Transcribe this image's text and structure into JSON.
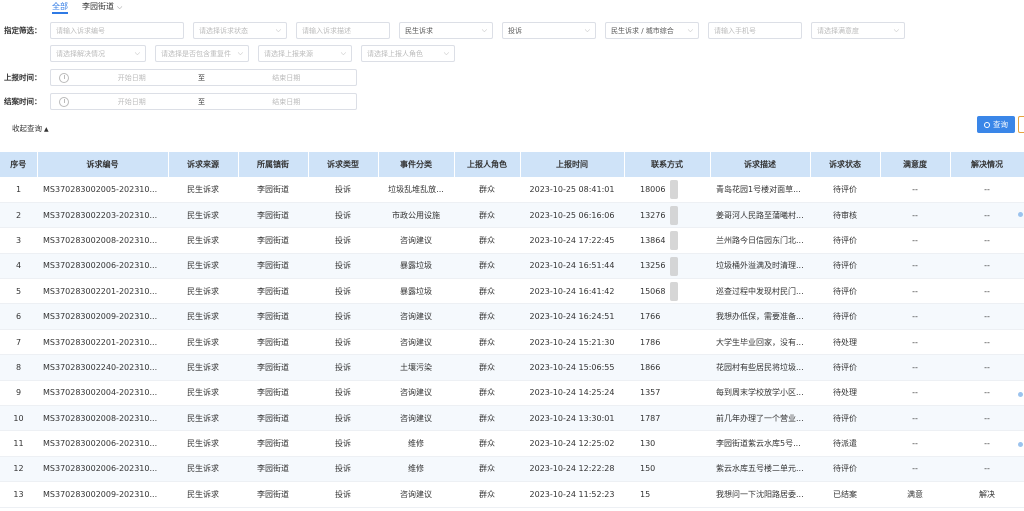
{
  "tabs": [
    {
      "label": "全部"
    },
    {
      "label": "李园街道"
    }
  ],
  "filters": {
    "label": "指定筛选：",
    "row1": [
      {
        "text": "请输入诉求编号",
        "filled": false,
        "arrow": false,
        "w": 134
      },
      {
        "text": "请选择诉求状态",
        "filled": false,
        "arrow": true,
        "w": 94
      },
      {
        "text": "请输入诉求描述",
        "filled": false,
        "arrow": false,
        "w": 94
      },
      {
        "text": "民生诉求",
        "filled": true,
        "arrow": true,
        "w": 94
      },
      {
        "text": "投诉",
        "filled": true,
        "arrow": true,
        "w": 94
      },
      {
        "text": "民生诉求 / 城市综合",
        "filled": true,
        "arrow": true,
        "w": 94
      },
      {
        "text": "请输入手机号",
        "filled": false,
        "arrow": false,
        "w": 94
      },
      {
        "text": "请选择满意度",
        "filled": false,
        "arrow": true,
        "w": 94
      }
    ],
    "row2": [
      {
        "text": "请选择解决情况",
        "filled": false,
        "arrow": true,
        "w": 96
      },
      {
        "text": "请选择是否包含重复件",
        "filled": false,
        "arrow": true,
        "w": 94
      },
      {
        "text": "请选择上报来源",
        "filled": false,
        "arrow": true,
        "w": 94
      },
      {
        "text": "请选择上报人角色",
        "filled": false,
        "arrow": true,
        "w": 94
      }
    ]
  },
  "report_time": {
    "label": "上报时间：",
    "start": "开始日期",
    "to": "至",
    "end": "结束日期"
  },
  "close_time": {
    "label": "结案时间：",
    "start": "开始日期",
    "to": "至",
    "end": "结束日期"
  },
  "collapse_label": "收起查询",
  "query_label": "查询",
  "table": {
    "columns": [
      "序号",
      "诉求编号",
      "诉求来源",
      "所属镇街",
      "诉求类型",
      "事件分类",
      "上报人角色",
      "上报时间",
      "联系方式",
      "诉求描述",
      "诉求状态",
      "满意度",
      "解决情况"
    ],
    "rows": [
      [
        "1",
        "MS370283002005-202310...",
        "民生诉求",
        "李园街道",
        "投诉",
        "垃圾乱堆乱放...",
        "群众",
        "2023-10-25 08:41:01",
        "18006",
        "青岛花园1号楼对面草...",
        "待评价",
        "--",
        "--"
      ],
      [
        "2",
        "MS370283002203-202310...",
        "民生诉求",
        "李园街道",
        "投诉",
        "市政公用设施",
        "群众",
        "2023-10-25 06:16:06",
        "13276",
        "姜哥河人民路至蒲曦村...",
        "待审核",
        "--",
        "--"
      ],
      [
        "3",
        "MS370283002008-202310...",
        "民生诉求",
        "李园街道",
        "投诉",
        "咨询建议",
        "群众",
        "2023-10-24 17:22:45",
        "13864",
        "兰州路今日信园东门北...",
        "待评价",
        "--",
        "--"
      ],
      [
        "4",
        "MS370283002006-202310...",
        "民生诉求",
        "李园街道",
        "投诉",
        "暴露垃圾",
        "群众",
        "2023-10-24 16:51:44",
        "13256",
        "垃圾桶外溢满及时清理...",
        "待评价",
        "--",
        "--"
      ],
      [
        "5",
        "MS370283002201-202310...",
        "民生诉求",
        "李园街道",
        "投诉",
        "暴露垃圾",
        "群众",
        "2023-10-24 16:41:42",
        "15068",
        "巡查过程中发现村民门...",
        "待评价",
        "--",
        "--"
      ],
      [
        "6",
        "MS370283002009-202310...",
        "民生诉求",
        "李园街道",
        "投诉",
        "咨询建议",
        "群众",
        "2023-10-24 16:24:51",
        "1766",
        "我想办低保，需要准备...",
        "待评价",
        "--",
        "--"
      ],
      [
        "7",
        "MS370283002201-202310...",
        "民生诉求",
        "李园街道",
        "投诉",
        "咨询建议",
        "群众",
        "2023-10-24 15:21:30",
        "1786",
        "大学生毕业回家，没有...",
        "待处理",
        "--",
        "--"
      ],
      [
        "8",
        "MS370283002240-202310...",
        "民生诉求",
        "李园街道",
        "投诉",
        "土壤污染",
        "群众",
        "2023-10-24 15:06:55",
        "1866",
        "花园村有些居民将垃圾...",
        "待评价",
        "--",
        "--"
      ],
      [
        "9",
        "MS370283002004-202310...",
        "民生诉求",
        "李园街道",
        "投诉",
        "咨询建议",
        "群众",
        "2023-10-24 14:25:24",
        "1357",
        "每到周末学校放学小区...",
        "待处理",
        "--",
        "--"
      ],
      [
        "10",
        "MS370283002008-202310...",
        "民生诉求",
        "李园街道",
        "投诉",
        "咨询建议",
        "群众",
        "2023-10-24 13:30:01",
        "1787",
        "前几年办理了一个营业...",
        "待评价",
        "--",
        "--"
      ],
      [
        "11",
        "MS370283002006-202310...",
        "民生诉求",
        "李园街道",
        "投诉",
        "维修",
        "群众",
        "2023-10-24 12:25:02",
        "130",
        "李园街道紫云水库5号...",
        "待派遣",
        "--",
        "--"
      ],
      [
        "12",
        "MS370283002006-202310...",
        "民生诉求",
        "李园街道",
        "投诉",
        "维修",
        "群众",
        "2023-10-24 12:22:28",
        "150",
        "紫云水库五号楼二单元...",
        "待评价",
        "--",
        "--"
      ],
      [
        "13",
        "MS370283002009-202310...",
        "民生诉求",
        "李园街道",
        "投诉",
        "咨询建议",
        "群众",
        "2023-10-24 11:52:23",
        "15",
        "我想问一下沈阳路居委...",
        "已结案",
        "满意",
        "解决"
      ]
    ]
  }
}
